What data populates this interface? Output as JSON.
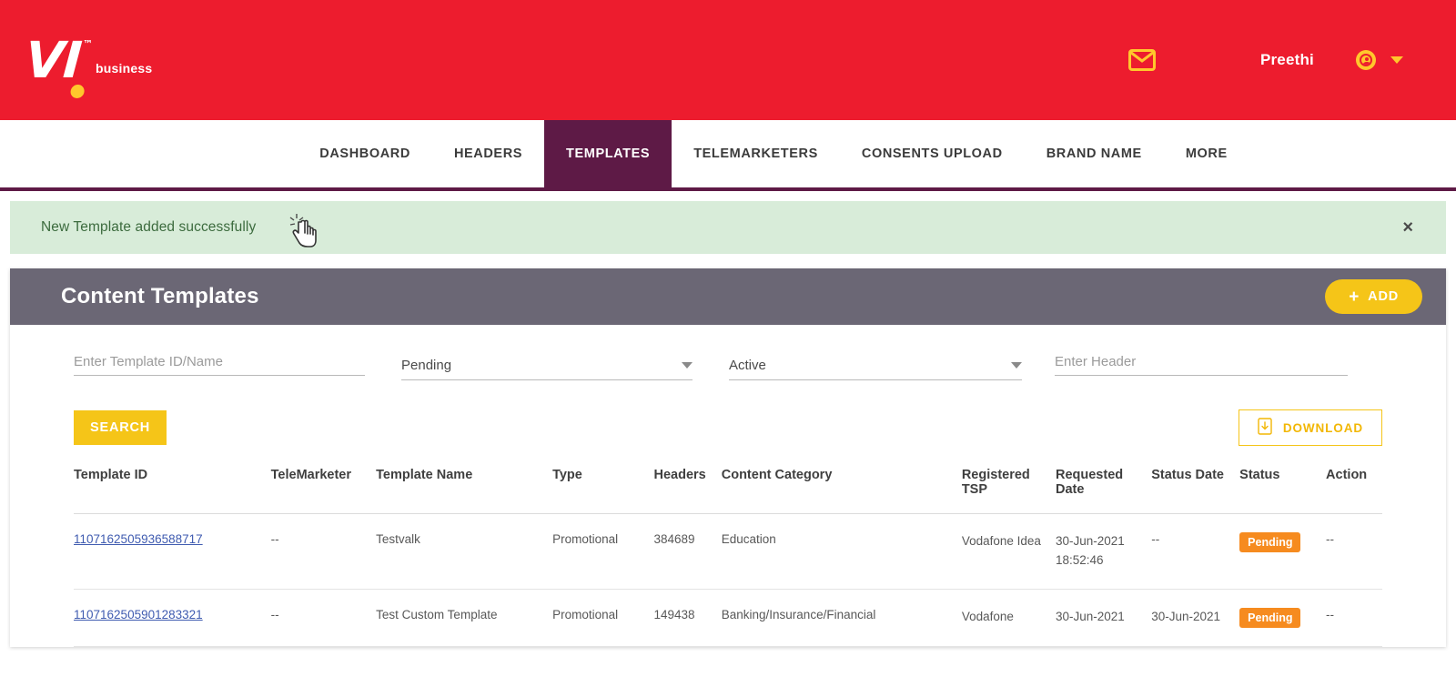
{
  "header": {
    "logo_main": "VI",
    "logo_tm": "™",
    "logo_sub": "business",
    "mail_icon": "envelope-icon",
    "user_name": "Preethi",
    "avatar_icon": "user-avatar-icon",
    "caret_icon": "chevron-down-icon",
    "bg_color": "#ED1C2E",
    "accent_color": "#FFC72C"
  },
  "nav": {
    "items": [
      {
        "label": "DASHBOARD",
        "active": false
      },
      {
        "label": "HEADERS",
        "active": false
      },
      {
        "label": "TEMPLATES",
        "active": true
      },
      {
        "label": "TELEMARKETERS",
        "active": false
      },
      {
        "label": "CONSENTS UPLOAD",
        "active": false
      },
      {
        "label": "BRAND NAME",
        "active": false
      },
      {
        "label": "MORE",
        "active": false
      }
    ],
    "active_color": "#5E1A46"
  },
  "alert": {
    "message": "New Template added successfully",
    "close_label": "×",
    "bg_color": "#d8ecd9",
    "text_color": "#3c6b3e"
  },
  "card": {
    "title": "Content Templates",
    "add_label": "ADD",
    "add_plus": "+",
    "header_bg": "#6b6775",
    "button_color": "#F5C518"
  },
  "filters": {
    "template_id_placeholder": "Enter Template ID/Name",
    "status_value": "Pending",
    "active_value": "Active",
    "header_placeholder": "Enter Header"
  },
  "actions": {
    "search_label": "SEARCH",
    "download_label": "DOWNLOAD",
    "download_icon": "file-download-icon"
  },
  "table": {
    "columns": [
      "Template ID",
      "TeleMarketer",
      "Template Name",
      "Type",
      "Headers",
      "Content Category",
      "Registered TSP",
      "Requested Date",
      "Status Date",
      "Status",
      "Action"
    ],
    "rows": [
      {
        "template_id": "1107162505936588717",
        "telemarketer": "--",
        "template_name": "Testvalk",
        "type": "Promotional",
        "headers": "384689",
        "content_category": "Education",
        "registered_tsp": "Vodafone Idea",
        "requested_date": "30-Jun-2021 18:52:46",
        "status_date": "--",
        "status": "Pending",
        "action": "--"
      },
      {
        "template_id": "1107162505901283321",
        "telemarketer": "--",
        "template_name": "Test Custom Template",
        "type": "Promotional",
        "headers": "149438",
        "content_category": "Banking/Insurance/Financial",
        "registered_tsp": "Vodafone",
        "requested_date": "30-Jun-2021",
        "status_date": "30-Jun-2021",
        "status": "Pending",
        "action": "--"
      }
    ],
    "status_badge_color": "#F68B1F"
  }
}
